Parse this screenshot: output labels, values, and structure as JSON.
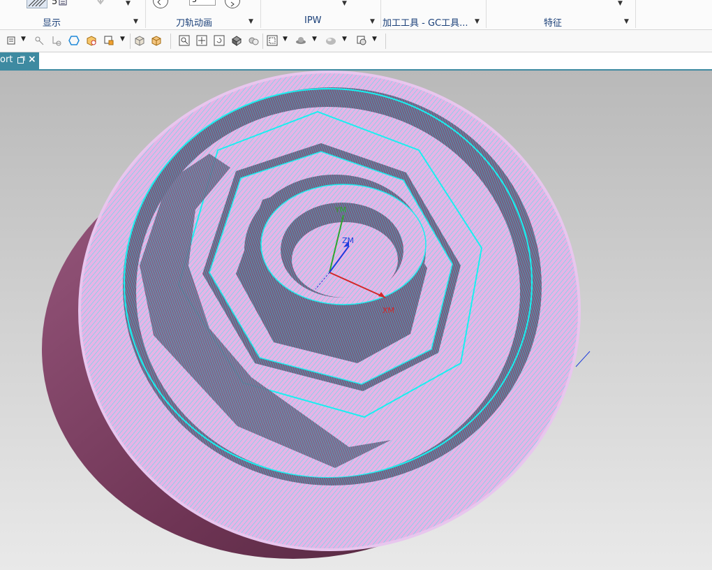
{
  "ribbon": {
    "groups": [
      {
        "label": "显示"
      },
      {
        "label": "刀轨动画"
      },
      {
        "label": "IPW"
      },
      {
        "label": "加工工具 - GC工具..."
      },
      {
        "label": "特征"
      }
    ],
    "stepper_value": "5"
  },
  "toolbar": {
    "icons": [
      "filter-icon",
      "snap-point-icon",
      "snap-end-icon",
      "hexagon-icon",
      "cube-snap-icon",
      "box-select-icon",
      "shaded-box-icon",
      "wire-box-icon",
      "zoom-fit-icon",
      "pan-icon",
      "rotate-icon",
      "shade-icon",
      "edges-icon",
      "fit-view-icon",
      "render-style-icon",
      "solid-sphere-icon",
      "layer-icon"
    ]
  },
  "tab": {
    "label": "ort",
    "close": "×"
  },
  "viewport": {
    "axis_labels": {
      "x": "XM",
      "y": "YM",
      "z": "ZM"
    },
    "colors": {
      "part_top": "#e6b4e6",
      "toolpath": "#19f0f0",
      "part_side": "#7a3d5e",
      "x_axis": "#d22828",
      "y_axis": "#2ea52e",
      "z_axis": "#1e3cdc"
    }
  }
}
